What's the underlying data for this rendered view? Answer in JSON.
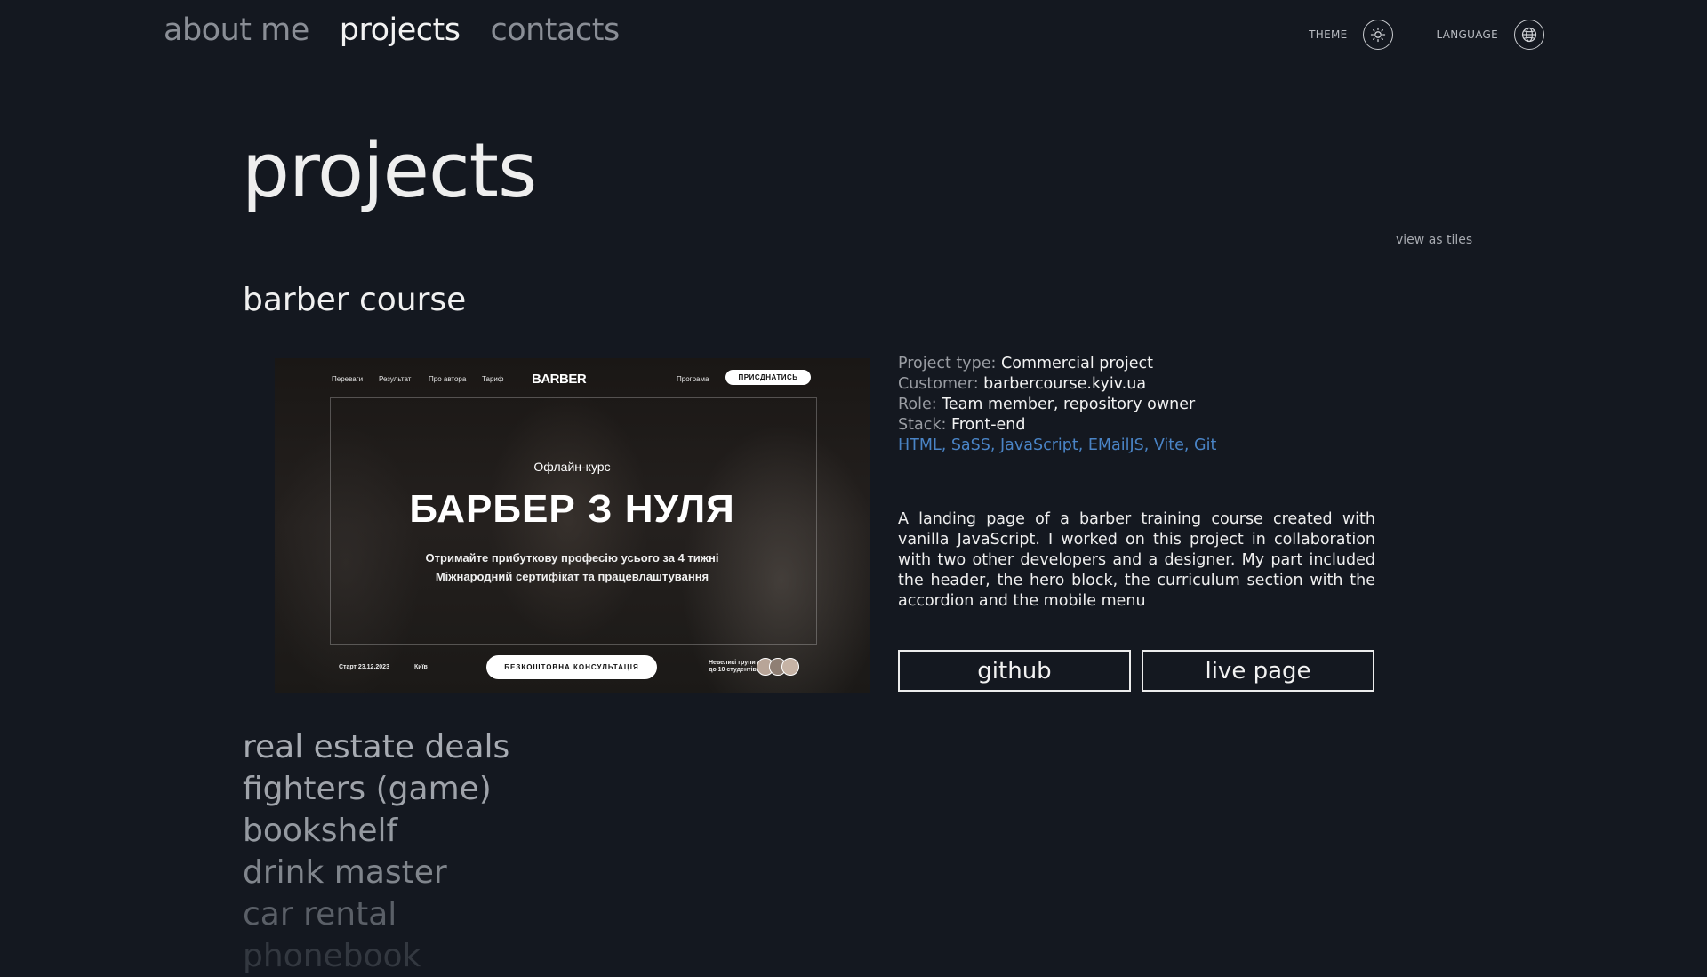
{
  "nav": {
    "items": [
      "about me",
      "projects",
      "contacts"
    ],
    "active_index": 1
  },
  "controls": {
    "theme_label": "THEME",
    "theme_icon": "sun-icon",
    "language_label": "LANGUAGE",
    "language_icon": "globe-icon"
  },
  "page": {
    "title": "projects",
    "view_toggle": "view as tiles"
  },
  "project": {
    "title": "barber course",
    "preview": {
      "nav_links": [
        "Переваги",
        "Результат",
        "Про автора",
        "Тариф"
      ],
      "logo": "BARBER",
      "nav_right_link": "Програма",
      "nav_button": "ПРИСДНАТИСЬ",
      "subtitle": "Офлайн-курс",
      "headline": "БАРБЕР З НУЛЯ",
      "desc_line1": "Отримайте прибуткову професію усього за 4 тижні",
      "desc_line2": "Міжнародний сертифікат та працевлаштування",
      "start": "Старт 23.12.2023",
      "city": "Київ",
      "cta": "БЕЗКОШТОВНА КОНСУЛЬТАЦІЯ",
      "groups_line1": "Невеликі групи",
      "groups_line2": "до 10 студентів"
    },
    "info": {
      "type_label": "Project type:",
      "type_value": "Commercial project",
      "customer_label": "Customer:",
      "customer_value": "barbercourse.kyiv.ua",
      "role_label": "Role:",
      "role_value": "Team member, repository owner",
      "stack_label": "Stack:",
      "stack_value": "Front-end",
      "technologies": "HTML, SaSS, JavaScript, EMailJS, Vite, Git"
    },
    "description": "A landing page of a barber training course created with vanilla JavaScript. I worked on this project in collaboration with two other developers and a designer. My part included the header, the hero block, the curriculum section with the accordion and the mobile menu",
    "buttons": {
      "github": "github",
      "live": "live page"
    }
  },
  "other_projects": [
    "real estate deals",
    "fighters (game)",
    "bookshelf",
    "drink master",
    "car rental",
    "phonebook"
  ],
  "colors": {
    "background": "#141820",
    "accent_link": "#4a84c6",
    "muted_text": "#9a9da3"
  }
}
